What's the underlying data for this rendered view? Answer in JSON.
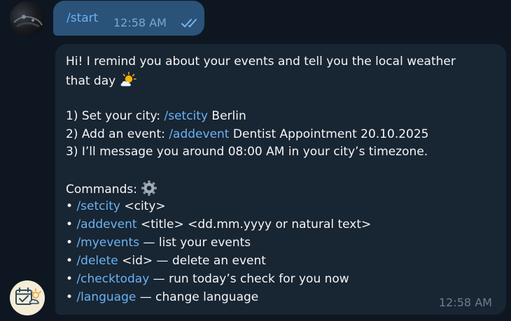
{
  "outgoing": {
    "text": "/start",
    "time": "12:58 AM"
  },
  "incoming": {
    "intro_line1": "Hi! I remind you about your events and tell you the local weather",
    "intro_line2": "that day",
    "steps": [
      {
        "prefix": "1) Set your city: ",
        "link": "/setcity",
        "suffix": " Berlin"
      },
      {
        "prefix": "2) Add an event: ",
        "link": "/addevent",
        "suffix": " Dentist Appointment 20.10.2025"
      },
      {
        "prefix": "3) I’ll message you around 08:00 AM in your city’s timezone.",
        "link": "",
        "suffix": ""
      }
    ],
    "commands_heading": "Commands:",
    "commands": [
      {
        "bullet": "• ",
        "link": "/setcity",
        "suffix": " <city>"
      },
      {
        "bullet": "• ",
        "link": "/addevent",
        "suffix": " <title> <dd.mm.yyyy or natural text>"
      },
      {
        "bullet": "• ",
        "link": "/myevents",
        "suffix": " — list your events"
      },
      {
        "bullet": "• ",
        "link": "/delete",
        "suffix": " <id> — delete an event"
      },
      {
        "bullet": "• ",
        "link": "/checktoday",
        "suffix": " — run today’s check for you now"
      },
      {
        "bullet": "• ",
        "link": "/language",
        "suffix": " — change language"
      }
    ],
    "time": "12:58 AM"
  },
  "icons": {
    "read_status": "double-check-icon",
    "weather_emoji": "sun-behind-cloud-icon",
    "gear_emoji": "gear-icon",
    "bot_avatar": "calendar-weather-icon"
  },
  "colors": {
    "background": "#0e1621",
    "outgoing_bubble": "#2b5278",
    "incoming_bubble": "#182533",
    "link": "#6ab3f3",
    "text": "#f5f5f5"
  }
}
